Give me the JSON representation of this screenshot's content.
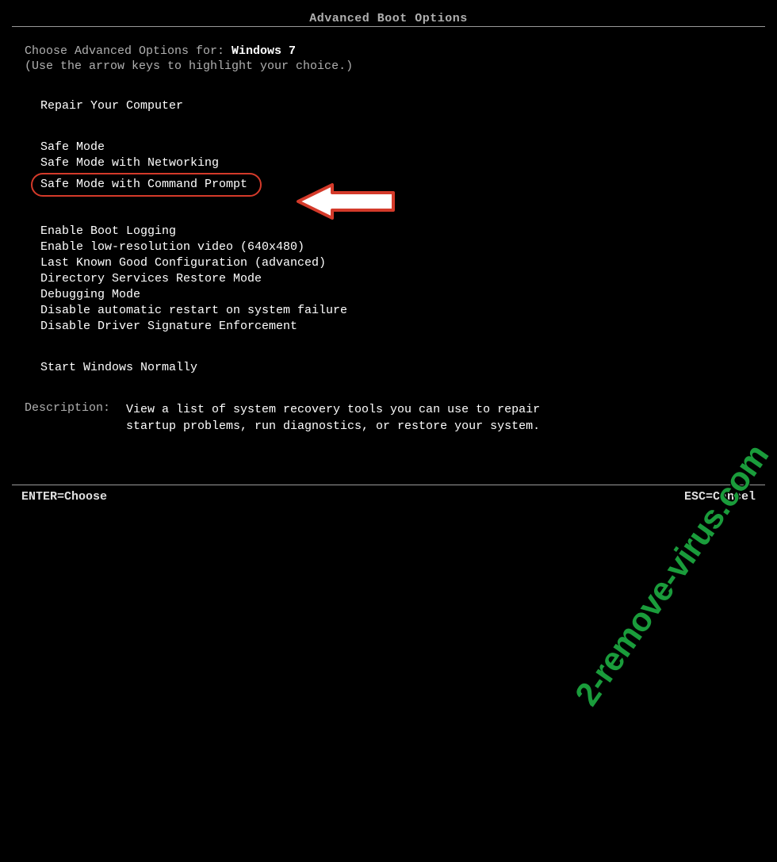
{
  "title": "Advanced Boot Options",
  "choose_label": "Choose Advanced Options for: ",
  "os_name": "Windows 7",
  "hint": "(Use the arrow keys to highlight your choice.)",
  "group1": {
    "items": [
      "Repair Your Computer"
    ]
  },
  "group2": {
    "items": [
      "Safe Mode",
      "Safe Mode with Networking",
      "Safe Mode with Command Prompt"
    ],
    "highlighted_index": 2
  },
  "group3": {
    "items": [
      "Enable Boot Logging",
      "Enable low-resolution video (640x480)",
      "Last Known Good Configuration (advanced)",
      "Directory Services Restore Mode",
      "Debugging Mode",
      "Disable automatic restart on system failure",
      "Disable Driver Signature Enforcement"
    ]
  },
  "group4": {
    "items": [
      "Start Windows Normally"
    ]
  },
  "description": {
    "label": "Description:",
    "text_line1": "View a list of system recovery tools you can use to repair",
    "text_line2": "startup problems, run diagnostics, or restore your system."
  },
  "footer": {
    "enter": "ENTER=Choose",
    "esc": "ESC=Cancel"
  },
  "watermark": "2-remove-virus.com"
}
